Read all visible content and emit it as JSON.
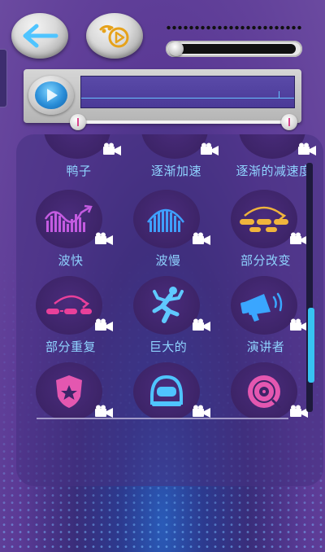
{
  "header": {
    "back_icon": "back-arrow-icon",
    "video_icon": "video-camera-play-icon"
  },
  "player": {
    "play_icon": "play-icon",
    "colors": {
      "accent": "#2a8ed8",
      "wave": "#67c1ff",
      "handle": "#d9468d"
    }
  },
  "effects": [
    {
      "label": "鸭子",
      "icon": "duck-icon"
    },
    {
      "label": "逐渐加速",
      "icon": "speed-up-icon"
    },
    {
      "label": "逐渐的减速度",
      "icon": "slow-down-icon"
    },
    {
      "label": "波快",
      "icon": "wave-fast-icon"
    },
    {
      "label": "波慢",
      "icon": "wave-slow-icon"
    },
    {
      "label": "部分改变",
      "icon": "partial-change-icon"
    },
    {
      "label": "部分重复",
      "icon": "partial-repeat-icon"
    },
    {
      "label": "巨大的",
      "icon": "giant-icon"
    },
    {
      "label": "演讲者",
      "icon": "megaphone-icon"
    },
    {
      "label": "",
      "icon": "police-badge-icon"
    },
    {
      "label": "",
      "icon": "astronaut-helmet-icon"
    },
    {
      "label": "",
      "icon": "vinyl-disc-icon"
    }
  ],
  "effect_badge_icon": "video-camera-icon"
}
